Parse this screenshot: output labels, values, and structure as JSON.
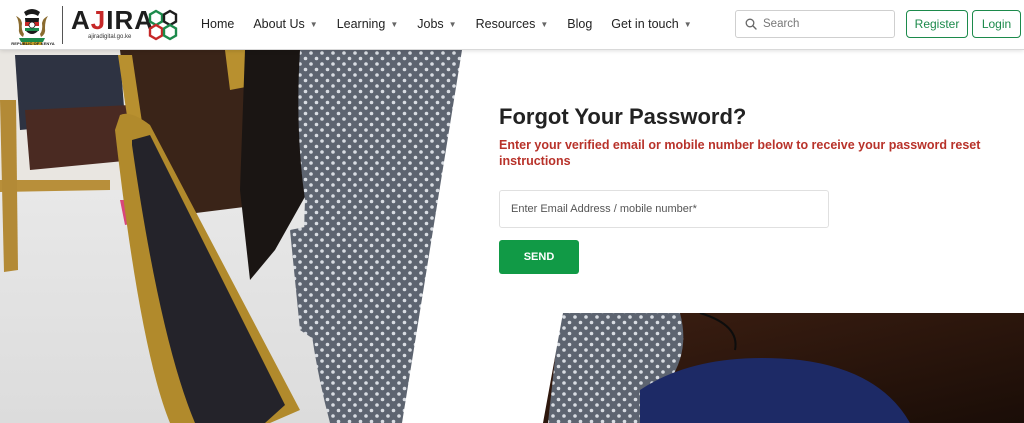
{
  "brand": {
    "emblem_caption": "REPUBLIC OF KENYA",
    "wordmark_a": "A",
    "wordmark_j": "J",
    "wordmark_rest": "IRA",
    "tagline": "ajiradigital.go.ke",
    "colors": {
      "primary_green": "#1c8a4b",
      "accent_red": "#c62828"
    }
  },
  "nav": {
    "items": [
      {
        "label": "Home",
        "dropdown": false
      },
      {
        "label": "About Us",
        "dropdown": true
      },
      {
        "label": "Learning",
        "dropdown": true
      },
      {
        "label": "Jobs",
        "dropdown": true
      },
      {
        "label": "Resources",
        "dropdown": true
      },
      {
        "label": "Blog",
        "dropdown": false
      },
      {
        "label": "Get in touch",
        "dropdown": true
      }
    ],
    "dropdown_icon": "chevron-down-icon"
  },
  "search": {
    "placeholder": "Search",
    "icon": "search-icon"
  },
  "auth": {
    "register_label": "Register",
    "login_label": "Login"
  },
  "form": {
    "title": "Forgot Your Password?",
    "subtitle": "Enter your verified email or mobile number below to receive your password reset instructions",
    "input_placeholder": "Enter Email Address / mobile number*",
    "input_value": "",
    "submit_label": "SEND",
    "colors": {
      "subtitle_red": "#b8322a",
      "send_green": "#119a46"
    }
  }
}
